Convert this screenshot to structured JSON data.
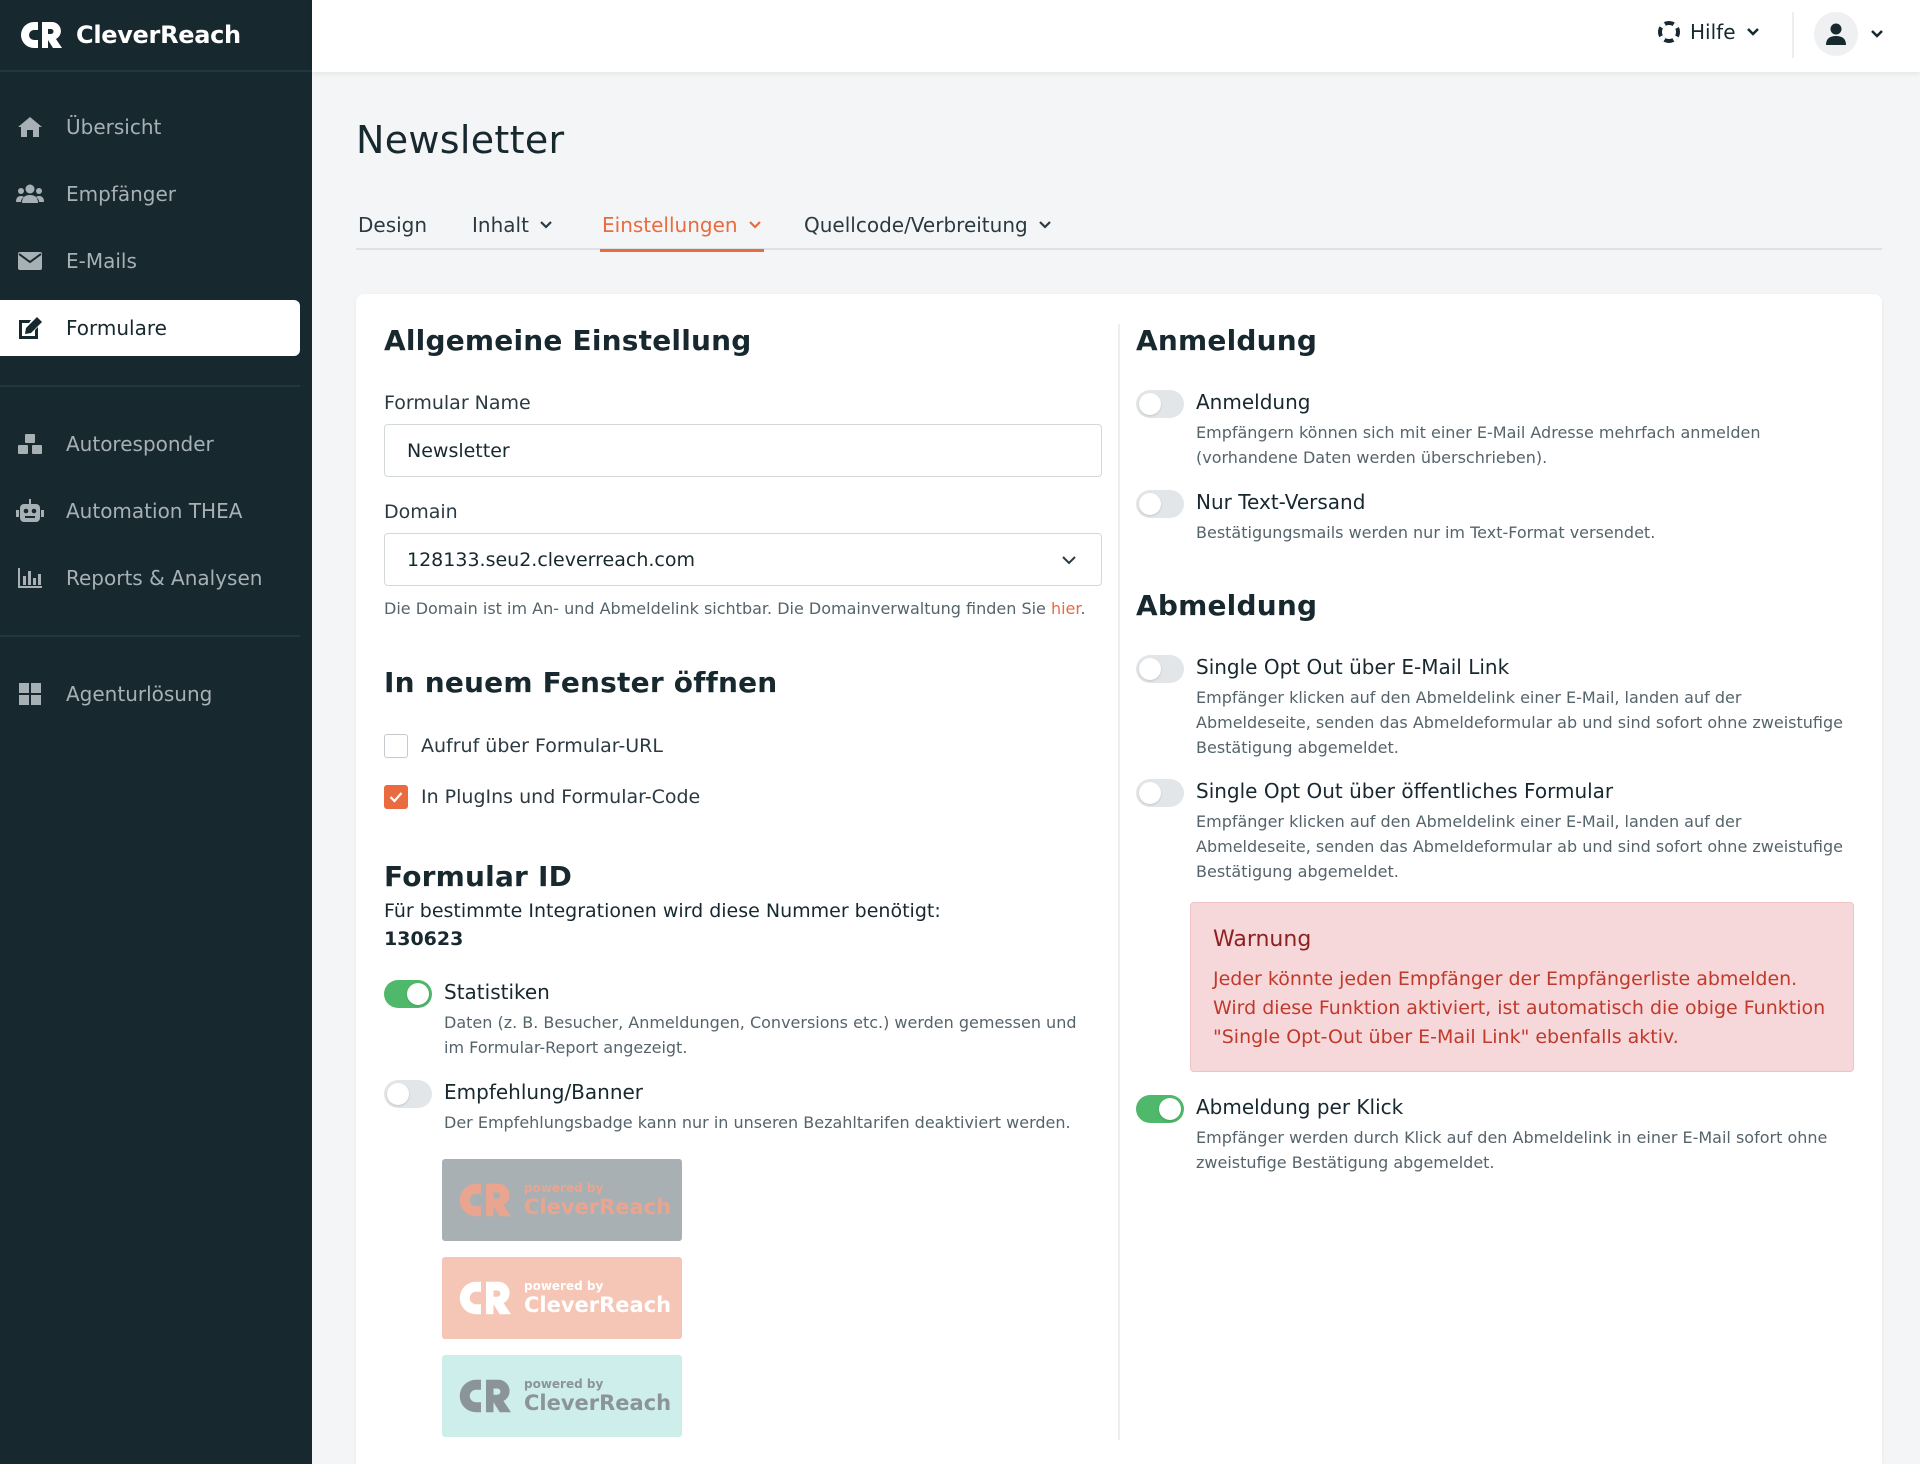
{
  "app": {
    "brand": "CleverReach"
  },
  "sidebar": {
    "items": [
      {
        "label": "Übersicht",
        "icon": "home-icon"
      },
      {
        "label": "Empfänger",
        "icon": "users-icon"
      },
      {
        "label": "E-Mails",
        "icon": "envelope-icon"
      },
      {
        "label": "Formulare",
        "icon": "edit-form-icon",
        "active": true
      },
      {
        "label": "Autoresponder",
        "icon": "cubes-icon"
      },
      {
        "label": "Automation THEA",
        "icon": "robot-icon"
      },
      {
        "label": "Reports & Analysen",
        "icon": "bar-chart-icon"
      },
      {
        "label": "Agenturlösung",
        "icon": "grid-icon"
      }
    ]
  },
  "topbar": {
    "help_label": "Hilfe"
  },
  "page": {
    "title": "Newsletter",
    "tabs": [
      {
        "label": "Design",
        "dropdown": false
      },
      {
        "label": "Inhalt",
        "dropdown": true
      },
      {
        "label": "Einstellungen",
        "dropdown": true,
        "active": true
      },
      {
        "label": "Quellcode/Verbreitung",
        "dropdown": true
      }
    ]
  },
  "general": {
    "heading": "Allgemeine Einstellung",
    "form_name_label": "Formular Name",
    "form_name_value": "Newsletter",
    "domain_label": "Domain",
    "domain_value": "128133.seu2.cleverreach.com",
    "domain_hint": "Die Domain ist im An- und Abmeldelink sichtbar. Die Domainverwaltung finden Sie ",
    "domain_hint_link": "hier",
    "domain_hint_end": "."
  },
  "new_window": {
    "heading": "In neuem Fenster öffnen",
    "options": [
      {
        "label": "Aufruf über Formular-URL",
        "checked": false
      },
      {
        "label": "In PlugIns und Formular-Code",
        "checked": true
      }
    ]
  },
  "form_id": {
    "heading": "Formular ID",
    "description": "Für bestimmte Integrationen wird diese Nummer benötigt:",
    "value": "130623"
  },
  "left_toggles": [
    {
      "title": "Statistiken",
      "on": true,
      "desc_lines": [
        "Daten (z. B. Besucher, Anmeldungen, Conversions etc.) werden gemessen und",
        "im Formular-Report angezeigt."
      ]
    },
    {
      "title": "Empfehlung/Banner",
      "on": false,
      "desc_lines": [
        "Der Empfehlungsbadge kann nur in unseren Bezahltarifen deaktiviert werden."
      ]
    }
  ],
  "badges": [
    {
      "small": "powered by",
      "big": "CleverReach",
      "bg": "#a9b0b3",
      "fg": "#e9a58f"
    },
    {
      "small": "powered by",
      "big": "CleverReach",
      "bg": "#f5c5b6",
      "fg": "#ffffff"
    },
    {
      "small": "powered by",
      "big": "CleverReach",
      "bg": "#cdeeea",
      "fg": "#8b9598"
    }
  ],
  "anmeldung": {
    "heading": "Anmeldung",
    "toggles": [
      {
        "title": "Anmeldung",
        "on": false,
        "desc_lines": [
          "Empfängern können sich mit einer E-Mail Adresse mehrfach anmelden",
          "(vorhandene Daten werden überschrieben)."
        ]
      },
      {
        "title": "Nur Text-Versand",
        "on": false,
        "desc_lines": [
          "Bestätigungsmails werden nur im Text-Format versendet."
        ]
      }
    ]
  },
  "abmeldung": {
    "heading": "Abmeldung",
    "toggles": [
      {
        "title": "Single Opt Out über E-Mail Link",
        "on": false,
        "desc_lines": [
          "Empfänger klicken auf den Abmeldelink einer E-Mail, landen auf der",
          "Abmeldeseite, senden das Abmeldeformular ab und sind sofort ohne zweistufige",
          "Bestätigung abgemeldet."
        ]
      },
      {
        "title": "Single Opt Out über öffentliches Formular",
        "on": false,
        "desc_lines": [
          "Empfänger klicken auf den Abmeldelink einer E-Mail, landen auf der",
          "Abmeldeseite, senden das Abmeldeformular ab und sind sofort ohne zweistufige",
          "Bestätigung abgemeldet."
        ]
      },
      {
        "title": "Abmeldung per Klick",
        "on": true,
        "desc_lines": [
          "Empfänger werden durch Klick auf den Abmeldelink in einer E-Mail sofort ohne",
          "zweistufige Bestätigung abgemeldet."
        ]
      }
    ],
    "warning": {
      "title": "Warnung",
      "lines": [
        "Jeder könnte jeden Empfänger der Empfängerliste abmelden.",
        "Wird diese Funktion aktiviert, ist automatisch die obige Funktion",
        "\"Single Opt-Out über E-Mail Link\" ebenfalls aktiv."
      ]
    }
  },
  "colors": {
    "accent": "#e96b3f",
    "sidebar_bg": "#17282f",
    "toggle_on": "#4fb86b",
    "warning_bg": "#f7d8da"
  }
}
